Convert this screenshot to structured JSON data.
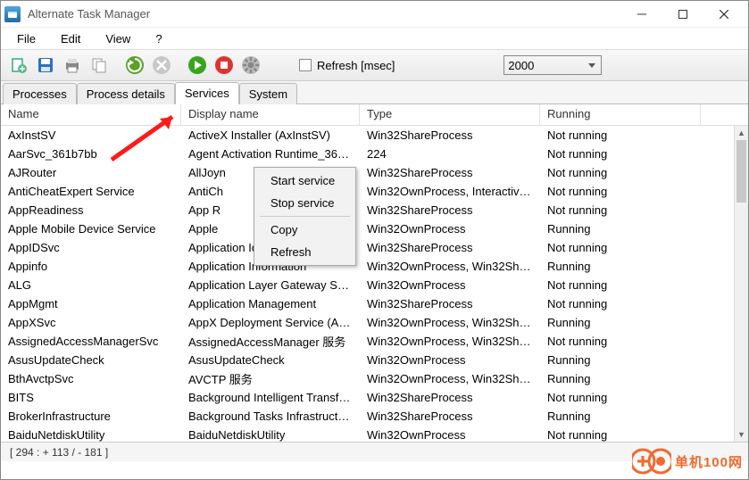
{
  "window": {
    "title": "Alternate Task Manager"
  },
  "menu": {
    "file": "File",
    "edit": "Edit",
    "view": "View",
    "help": "?"
  },
  "toolbar": {
    "refresh_label": "Refresh [msec]",
    "refresh_checked": false,
    "interval_value": "2000"
  },
  "tabs": {
    "processes": "Processes",
    "process_details": "Process details",
    "services": "Services",
    "system": "System",
    "active": "services"
  },
  "columns": {
    "name": "Name",
    "display": "Display name",
    "type": "Type",
    "running": "Running"
  },
  "rows": [
    {
      "name": "AxInstSV",
      "display": "ActiveX Installer (AxInstSV)",
      "type": "Win32ShareProcess",
      "running": "Not running"
    },
    {
      "name": "AarSvc_361b7bb",
      "display": "Agent Activation Runtime_361b...",
      "type": "224",
      "running": "Not running"
    },
    {
      "name": "AJRouter",
      "display": "AllJoyn",
      "type": "Win32ShareProcess",
      "running": "Not running"
    },
    {
      "name": "AntiCheatExpert Service",
      "display": "AntiCh",
      "type": "Win32OwnProcess, Interactive...",
      "running": "Not running"
    },
    {
      "name": "AppReadiness",
      "display": "App R",
      "type": "Win32ShareProcess",
      "running": "Not running"
    },
    {
      "name": "Apple Mobile Device Service",
      "display": "Apple",
      "type": "Win32OwnProcess",
      "running": "Running"
    },
    {
      "name": "AppIDSvc",
      "display": "Application Identity",
      "type": "Win32ShareProcess",
      "running": "Not running"
    },
    {
      "name": "Appinfo",
      "display": "Application Information",
      "type": "Win32OwnProcess, Win32Shar...",
      "running": "Running"
    },
    {
      "name": "ALG",
      "display": "Application Layer Gateway Ser...",
      "type": "Win32OwnProcess",
      "running": "Not running"
    },
    {
      "name": "AppMgmt",
      "display": "Application Management",
      "type": "Win32ShareProcess",
      "running": "Not running"
    },
    {
      "name": "AppXSvc",
      "display": "AppX Deployment Service (Ap...",
      "type": "Win32OwnProcess, Win32Shar...",
      "running": "Running"
    },
    {
      "name": "AssignedAccessManagerSvc",
      "display": "AssignedAccessManager 服务",
      "type": "Win32OwnProcess, Win32Shar...",
      "running": "Not running"
    },
    {
      "name": "AsusUpdateCheck",
      "display": "AsusUpdateCheck",
      "type": "Win32OwnProcess",
      "running": "Running"
    },
    {
      "name": "BthAvctpSvc",
      "display": "AVCTP 服务",
      "type": "Win32OwnProcess, Win32Shar...",
      "running": "Running"
    },
    {
      "name": "BITS",
      "display": "Background Intelligent Transfe...",
      "type": "Win32ShareProcess",
      "running": "Not running"
    },
    {
      "name": "BrokerInfrastructure",
      "display": "Background Tasks Infrastructu...",
      "type": "Win32ShareProcess",
      "running": "Running"
    },
    {
      "name": "BaiduNetdiskUtility",
      "display": "BaiduNetdiskUtility",
      "type": "Win32OwnProcess",
      "running": "Not running"
    }
  ],
  "context_menu": {
    "start": "Start service",
    "stop": "Stop service",
    "copy": "Copy",
    "refresh": "Refresh"
  },
  "status": {
    "text": "[ 294 : + 113 /  - 181 ]"
  },
  "watermark": {
    "text": "单机100网"
  }
}
